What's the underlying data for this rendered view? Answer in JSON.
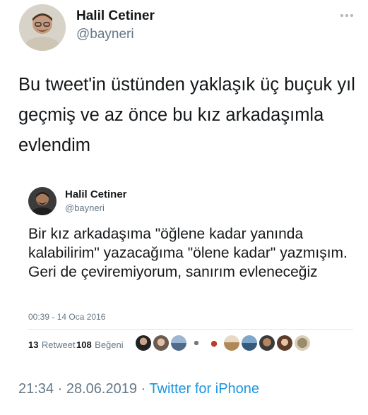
{
  "tweet": {
    "author_name": "Halil Cetiner",
    "author_handle": "@bayneri",
    "text": "Bu tweet'in üstünden yaklaşık üç buçuk yıl geçmiş ve az önce bu kız arkadaşımla evlendim",
    "time": "21:34",
    "separator": "·",
    "date": "28.06.2019",
    "source": "Twitter for iPhone"
  },
  "quoted": {
    "author_name": "Halil Cetiner",
    "author_handle": "@bayneri",
    "text": "Bir kız arkadaşıma \"öğlene kadar yanında kalabilirim\" yazacağıma \"ölene kadar\" yazmışım. Geri de çeviremiyorum, sanırım evleneceğiz",
    "timestamp": "00:39 - 14 Oca 2016",
    "retweets_count": "13",
    "retweets_label": "Retweet",
    "likes_count": "108",
    "likes_label": "Beğeni"
  },
  "icons": {
    "more": "more-dots-icon",
    "avatar": "user-avatar",
    "likers": "liker-avatar"
  },
  "colors": {
    "link": "#1b95e0",
    "secondary": "#657786",
    "divider": "#e1e8ed"
  }
}
